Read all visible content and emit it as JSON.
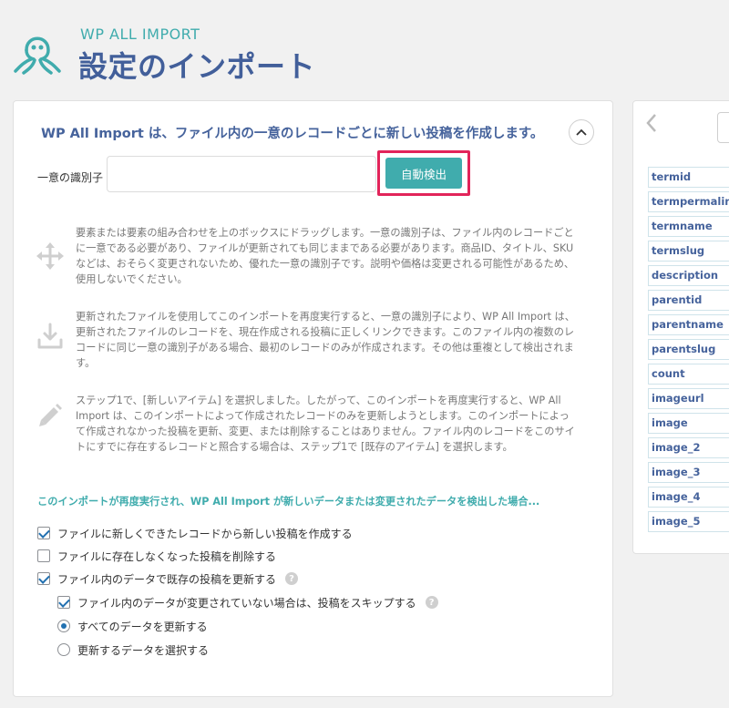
{
  "header": {
    "brand": "WP ALL IMPORT",
    "title": "設定のインポート"
  },
  "panel": {
    "title": "WP All Import は、ファイル内の一意のレコードごとに新しい投稿を作成します。",
    "uid_label": "一意の識別子",
    "uid_value": "",
    "auto_detect_label": "自動検出",
    "info": [
      {
        "icon": "move-icon",
        "text": "要素または要素の組み合わせを上のボックスにドラッグします。一意の識別子は、ファイル内のレコードごとに一意である必要があり、ファイルが更新されても同じままである必要があります。商品ID、タイトル、SKU などは、おそらく変更されないため、優れた一意の識別子です。説明や価格は変更される可能性があるため、使用しないでください。"
      },
      {
        "icon": "download-icon",
        "text": "更新されたファイルを使用してこのインポートを再度実行すると、一意の識別子により、WP All Import は、更新されたファイルのレコードを、現在作成される投稿に正しくリンクできます。このファイル内の複数のレコードに同じ一意の識別子がある場合、最初のレコードのみが作成されます。その他は重複として検出されます。"
      },
      {
        "icon": "pencil-icon",
        "text": "ステップ1で、[新しいアイテム] を選択しました。したがって、このインポートを再度実行すると、WP All Import は、このインポートによって作成されたレコードのみを更新しようとします。このインポートによって作成されなかった投稿を更新、変更、または削除することはありません。ファイル内のレコードをこのサイトにすでに存在するレコードと照合する場合は、ステップ1で [既存のアイテム] を選択します。"
      }
    ],
    "reimport_heading": "このインポートが再度実行され、WP All Import が新しいデータまたは変更されたデータを検出した場合...",
    "options": {
      "create_new": "ファイルに新しくできたレコードから新しい投稿を作成する",
      "delete_missing": "ファイルに存在しなくなった投稿を削除する",
      "update_existing": "ファイル内のデータで既存の投稿を更新する",
      "skip_unchanged": "ファイル内のデータが変更されていない場合は、投稿をスキップする",
      "update_all": "すべてのデータを更新する",
      "choose_data": "更新するデータを選択する",
      "help": "?"
    }
  },
  "fields": [
    "termid",
    "termpermalink",
    "termname",
    "termslug",
    "description",
    "parentid",
    "parentname",
    "parentslug",
    "count",
    "imageurl",
    "image",
    "image_2",
    "image_3",
    "image_4",
    "image_5"
  ],
  "colors": {
    "accent": "#40acad",
    "title": "#425f9a",
    "highlight": "#e2245a"
  }
}
